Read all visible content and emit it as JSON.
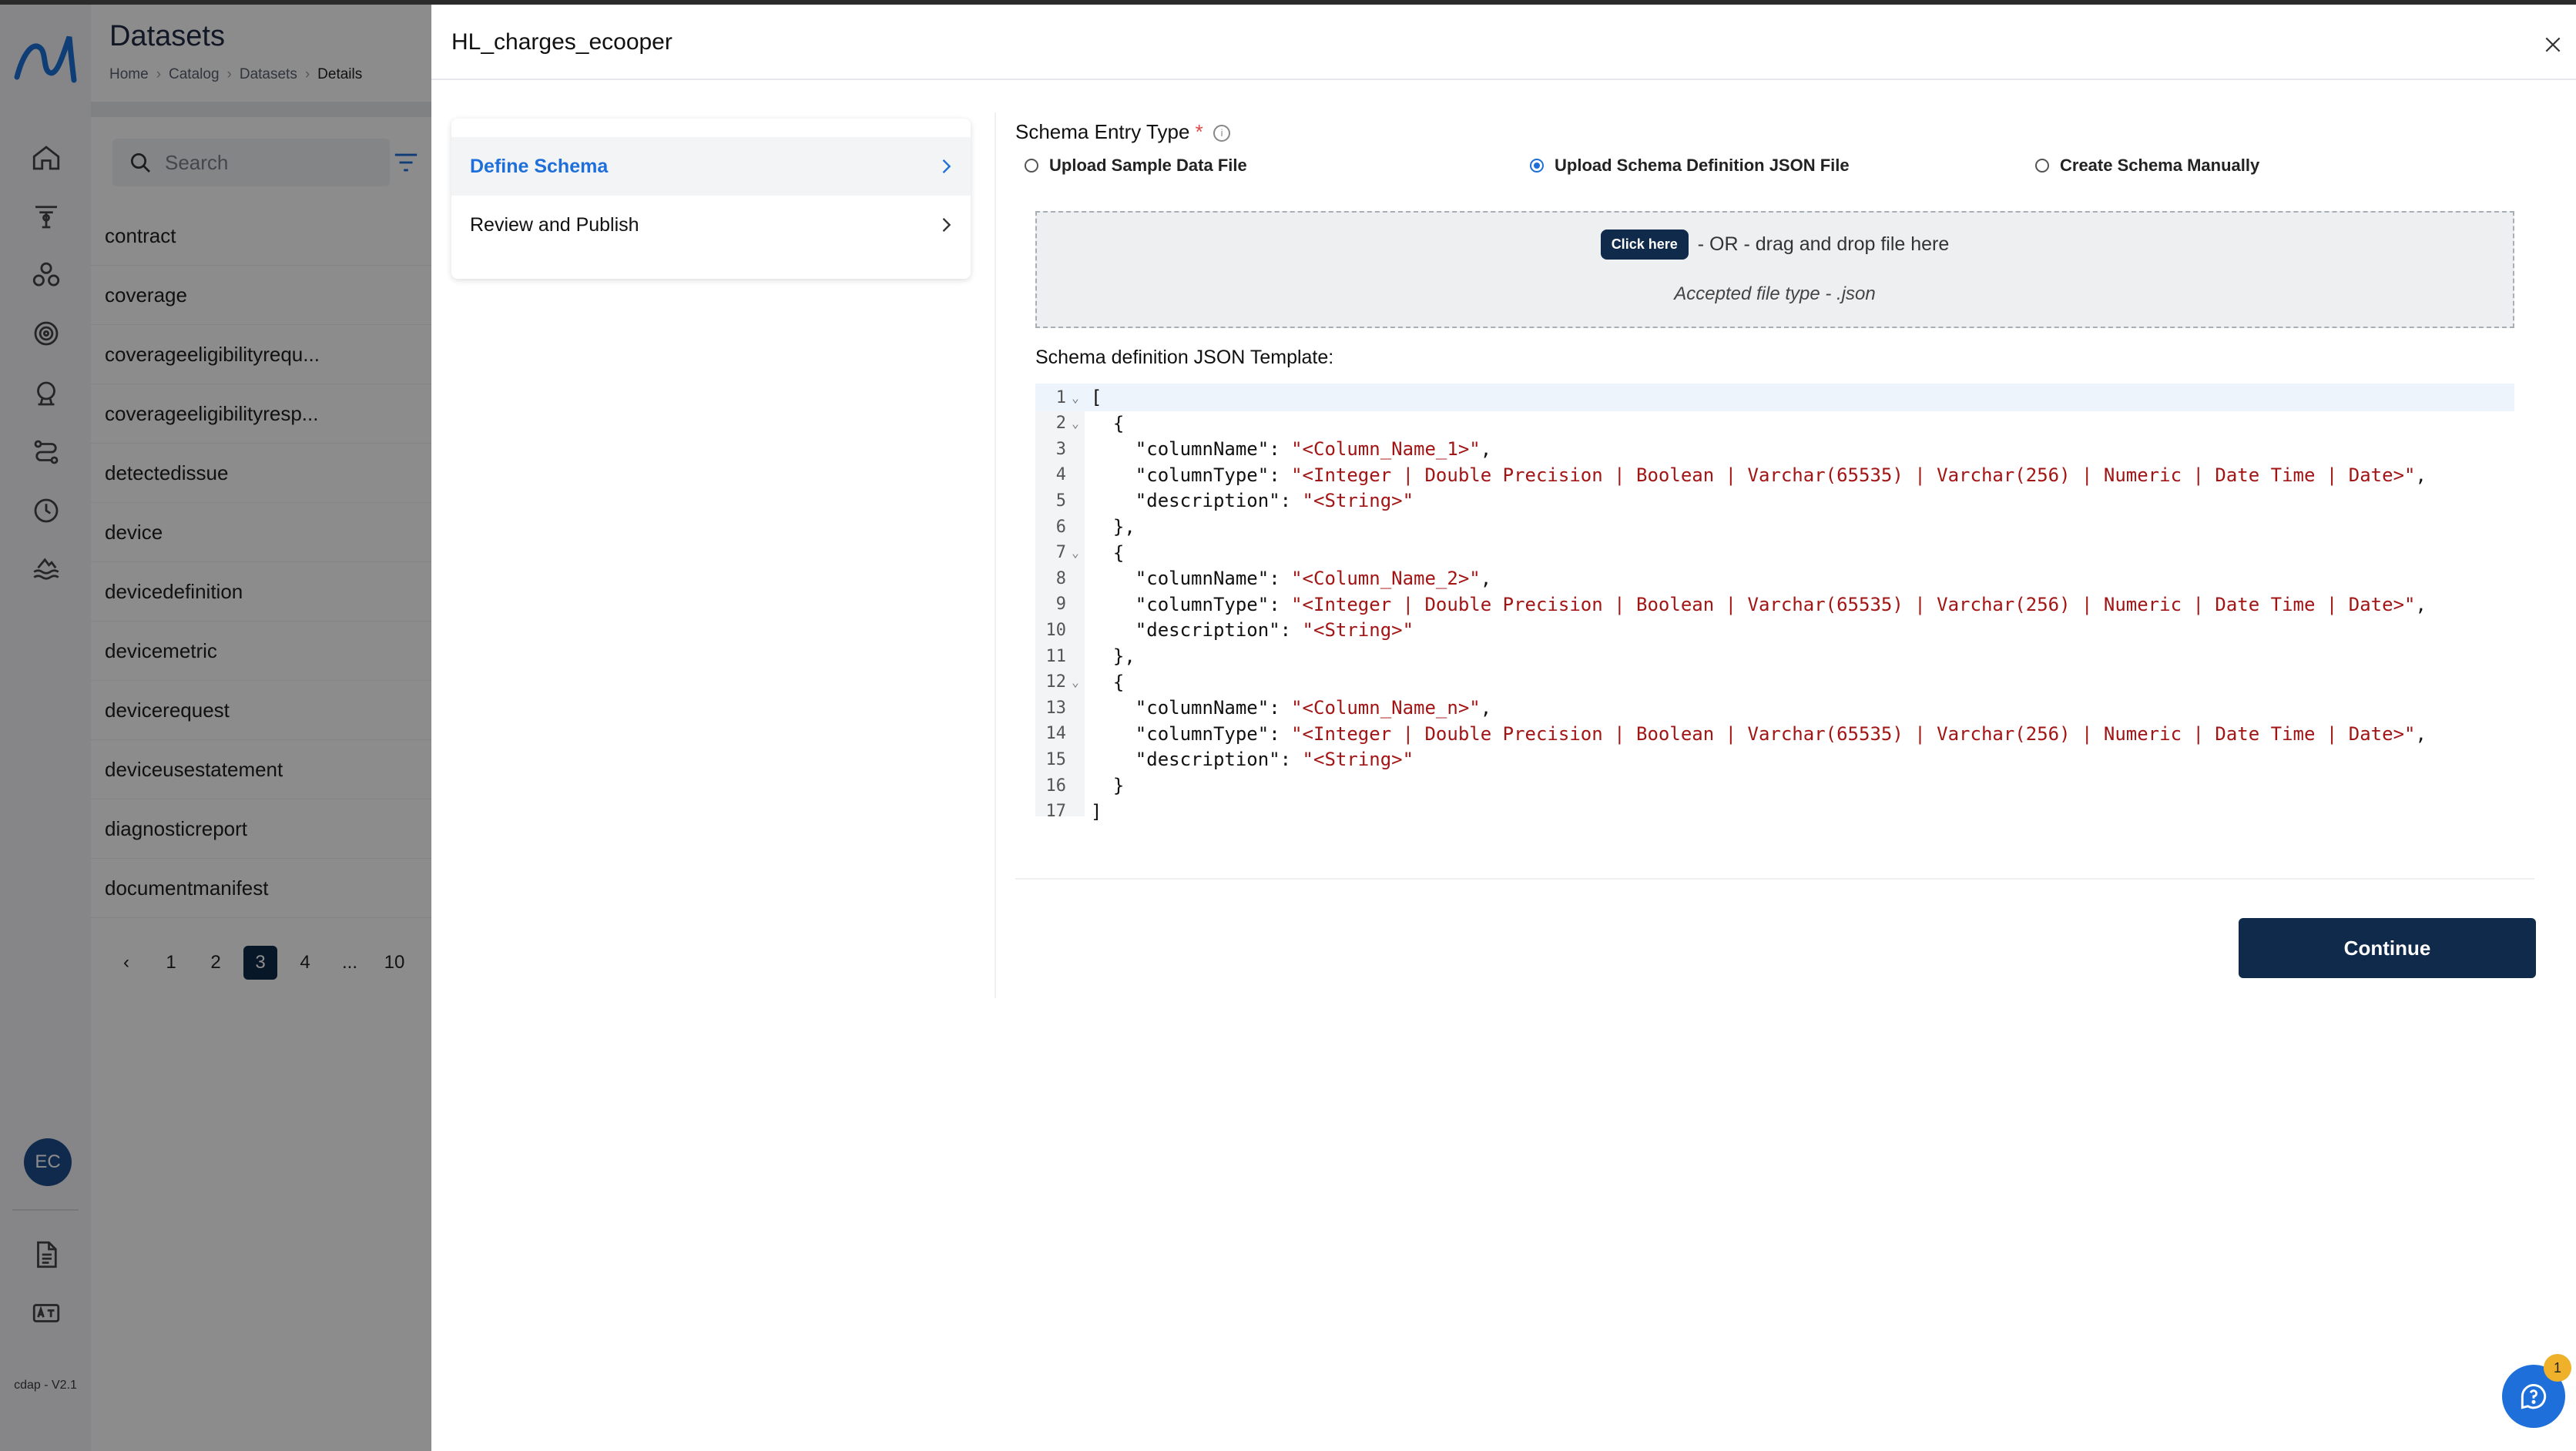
{
  "rail": {
    "avatar_initials": "EC",
    "version": "cdap - V2.1",
    "nav_icons": [
      "home-icon",
      "pipeline-icon",
      "groups-icon",
      "target-icon",
      "monitor-icon",
      "route-icon",
      "clock-icon",
      "data-lake-icon"
    ],
    "bottom_icons": [
      "document-icon",
      "translate-icon"
    ]
  },
  "list": {
    "title": "Datasets",
    "breadcrumb": [
      "Home",
      "Catalog",
      "Datasets",
      "Details"
    ],
    "search_placeholder": "Search",
    "items": [
      "contract",
      "coverage",
      "coverageeligibilityrequ...",
      "coverageeligibilityresp...",
      "detectedissue",
      "device",
      "devicedefinition",
      "devicemetric",
      "devicerequest",
      "deviceusestatement",
      "diagnosticreport",
      "documentmanifest"
    ],
    "pages": [
      "1",
      "2",
      "3",
      "4",
      "...",
      "10"
    ],
    "current_page": "3"
  },
  "drawer": {
    "title": "HL_charges_ecooper",
    "steps": [
      "Define Schema",
      "Review and Publish"
    ],
    "entry_type_label": "Schema Entry Type",
    "required_mark": "*",
    "radio_options": [
      "Upload Sample Data File",
      "Upload Schema Definition JSON File",
      "Create Schema Manually"
    ],
    "selected_option": "Upload Schema Definition JSON File",
    "dropzone": {
      "button": "Click here",
      "text": "- OR - drag and drop file here",
      "accepted": "Accepted file type - .json"
    },
    "template_label": "Schema definition JSON Template:",
    "code_lines": [
      "[",
      "  {",
      "    \"columnName\": \"<Column_Name_1>\",",
      "    \"columnType\": \"<Integer | Double Precision | Boolean | Varchar(65535) | Varchar(256) | Numeric | Date Time | Date>\",",
      "    \"description\": \"<String>\"",
      "  },",
      "  {",
      "    \"columnName\": \"<Column_Name_2>\",",
      "    \"columnType\": \"<Integer | Double Precision | Boolean | Varchar(65535) | Varchar(256) | Numeric | Date Time | Date>\",",
      "    \"description\": \"<String>\"",
      "  },",
      "  {",
      "    \"columnName\": \"<Column_Name_n>\",",
      "    \"columnType\": \"<Integer | Double Precision | Boolean | Varchar(65535) | Varchar(256) | Numeric | Date Time | Date>\",",
      "    \"description\": \"<String>\"",
      "  }",
      "]"
    ],
    "fold_lines": [
      1,
      2,
      7,
      12
    ],
    "continue_label": "Continue"
  },
  "help": {
    "badge": "1"
  },
  "colors": {
    "primary": "#0f2a4a",
    "accent": "#1e6fd9",
    "string": "#a31515"
  }
}
